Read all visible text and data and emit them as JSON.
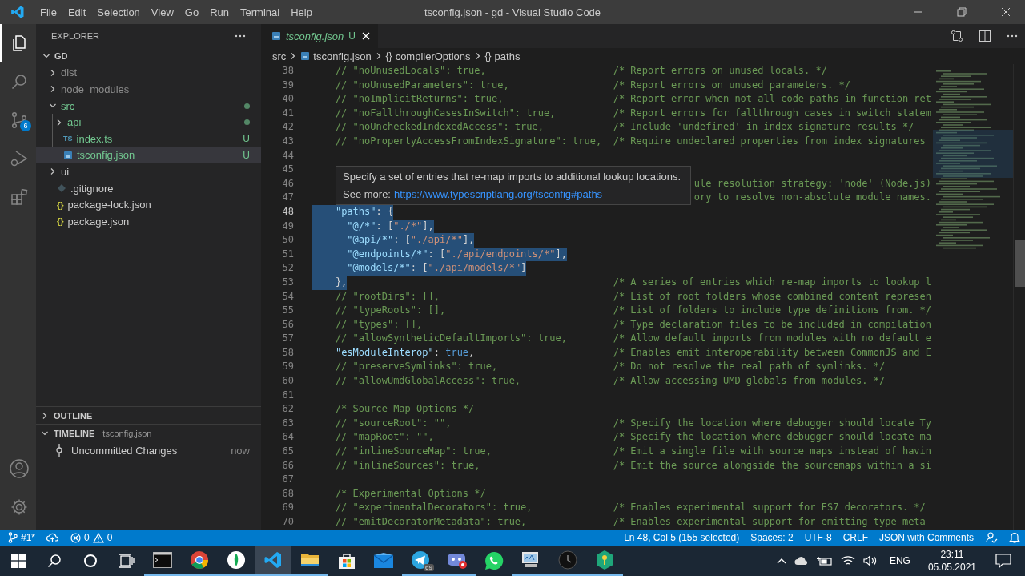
{
  "window": {
    "title": "tsconfig.json - gd - Visual Studio Code"
  },
  "menu": [
    "File",
    "Edit",
    "Selection",
    "View",
    "Go",
    "Run",
    "Terminal",
    "Help"
  ],
  "activity_bar": [
    {
      "kind": "explorer",
      "selected": true
    },
    {
      "kind": "search",
      "selected": false
    },
    {
      "kind": "source-control",
      "selected": false,
      "badge": "6"
    },
    {
      "kind": "run",
      "selected": false
    },
    {
      "kind": "extensions",
      "selected": false
    }
  ],
  "activity_bottom": [
    {
      "kind": "account"
    },
    {
      "kind": "settings"
    }
  ],
  "sidebar": {
    "title": "EXPLORER",
    "tree": [
      {
        "name": "GD",
        "kind": "root",
        "expanded": true,
        "ignored": false,
        "changed": false,
        "selected": false,
        "children": [
          {
            "name": "dist",
            "kind": "folder",
            "expanded": false,
            "ignored": true,
            "changed": false,
            "selected": false
          },
          {
            "name": "node_modules",
            "kind": "folder",
            "expanded": false,
            "ignored": true,
            "changed": false,
            "selected": false
          },
          {
            "name": "src",
            "kind": "folder",
            "expanded": true,
            "ignored": false,
            "changed": true,
            "selected": false,
            "children": [
              {
                "name": "api",
                "kind": "folder",
                "expanded": false,
                "ignored": false,
                "changed": true,
                "selected": false
              },
              {
                "name": "index.ts",
                "kind": "ts",
                "icon": "TS",
                "ignored": false,
                "changed": true,
                "badge": "U",
                "selected": false
              },
              {
                "name": "tsconfig.json",
                "kind": "tsconfig",
                "ignored": false,
                "changed": true,
                "badge": "U",
                "selected": true
              }
            ]
          },
          {
            "name": "ui",
            "kind": "folder",
            "expanded": false,
            "ignored": false,
            "changed": false,
            "selected": false
          },
          {
            "name": ".gitignore",
            "kind": "gitignore",
            "ignored": false,
            "changed": false,
            "selected": false
          },
          {
            "name": "package-lock.json",
            "kind": "json",
            "icon": "{}",
            "ignored": false,
            "changed": false,
            "selected": false
          },
          {
            "name": "package.json",
            "kind": "json",
            "icon": "{}",
            "ignored": false,
            "changed": false,
            "selected": false
          }
        ]
      }
    ],
    "outline": {
      "title": "OUTLINE",
      "expanded": false
    },
    "timeline": {
      "title": "TIMELINE",
      "file": "tsconfig.json",
      "expanded": true,
      "items": [
        {
          "label": "Uncommitted Changes",
          "time": "now"
        }
      ]
    }
  },
  "tabs": [
    {
      "label": "tsconfig.json",
      "status": "U",
      "selected": true
    }
  ],
  "breadcrumb": [
    {
      "label": "src",
      "kind": "folder"
    },
    {
      "label": "tsconfig.json",
      "kind": "file"
    },
    {
      "label": "compilerOptions",
      "kind": "object",
      "icon": "{}"
    },
    {
      "label": "paths",
      "kind": "object",
      "icon": "{}"
    }
  ],
  "editor": {
    "lines": [
      {
        "number": "38",
        "code": "    // \"noUnusedLocals\": true,",
        "comment": "/* Report errors on unused locals. */",
        "selected": false,
        "current": false
      },
      {
        "number": "39",
        "code": "    // \"noUnusedParameters\": true,",
        "comment": "/* Report errors on unused parameters. */",
        "selected": false,
        "current": false
      },
      {
        "number": "40",
        "code": "    // \"noImplicitReturns\": true,",
        "comment": "/* Report error when not all code paths in function ret",
        "selected": false,
        "current": false
      },
      {
        "number": "41",
        "code": "    // \"noFallthroughCasesInSwitch\": true,",
        "comment": "/* Report errors for fallthrough cases in switch statem",
        "selected": false,
        "current": false
      },
      {
        "number": "42",
        "code": "    // \"noUncheckedIndexedAccess\": true,",
        "comment": "/* Include 'undefined' in index signature results */",
        "selected": false,
        "current": false
      },
      {
        "number": "43",
        "code": "    // \"noPropertyAccessFromIndexSignature\": true,",
        "comment": "/* Require undeclared properties from index signatures",
        "selected": false,
        "current": false
      },
      {
        "number": "44",
        "current": false
      },
      {
        "number": "45",
        "current": false
      },
      {
        "number": "46",
        "kind": "covered",
        "comment": "ule resolution strategy: 'node' (Node.js)",
        "current": false
      },
      {
        "number": "47",
        "kind": "covered",
        "comment": "ory to resolve non-absolute module names.",
        "current": false
      },
      {
        "number": "48",
        "code": "    \"paths\": {",
        "selected": true,
        "current": true
      },
      {
        "number": "49",
        "code": "      \"@/*\": [\"./*\"],",
        "selected": true,
        "current": false
      },
      {
        "number": "50",
        "code": "      \"@api/*\": [\"./api/*\"],",
        "selected": true,
        "current": false
      },
      {
        "number": "51",
        "code": "      \"@endpoints/*\": [\"./api/endpoints/*\"],",
        "selected": true,
        "current": false
      },
      {
        "number": "52",
        "code": "      \"@models/*\": [\"./api/models/*\"]",
        "selected": true,
        "current": false
      },
      {
        "number": "53",
        "code": "    },",
        "comment": "/* A series of entries which re-map imports to lookup l",
        "selected": true,
        "current": false
      },
      {
        "number": "54",
        "code": "    // \"rootDirs\": [],",
        "comment": "/* List of root folders whose combined content represen",
        "selected": false,
        "current": false
      },
      {
        "number": "55",
        "code": "    // \"typeRoots\": [],",
        "comment": "/* List of folders to include type definitions from. */",
        "selected": false,
        "current": false
      },
      {
        "number": "56",
        "code": "    // \"types\": [],",
        "comment": "/* Type declaration files to be included in compilation",
        "selected": false,
        "current": false
      },
      {
        "number": "57",
        "code": "    // \"allowSyntheticDefaultImports\": true,",
        "comment": "/* Allow default imports from modules with no default e",
        "selected": false,
        "current": false
      },
      {
        "number": "58",
        "code": "    \"esModuleInterop\": true,",
        "comment": "/* Enables emit interoperability between CommonJS and E",
        "selected": false,
        "current": false
      },
      {
        "number": "59",
        "code": "    // \"preserveSymlinks\": true,",
        "comment": "/* Do not resolve the real path of symlinks. */",
        "selected": false,
        "current": false
      },
      {
        "number": "60",
        "code": "    // \"allowUmdGlobalAccess\": true,",
        "comment": "/* Allow accessing UMD globals from modules. */",
        "selected": false,
        "current": false
      },
      {
        "number": "61",
        "current": false
      },
      {
        "number": "62",
        "code": "    /* Source Map Options */",
        "selected": false,
        "current": false
      },
      {
        "number": "63",
        "code": "    // \"sourceRoot\": \"\",",
        "comment": "/* Specify the location where debugger should locate Ty",
        "selected": false,
        "current": false
      },
      {
        "number": "64",
        "code": "    // \"mapRoot\": \"\",",
        "comment": "/* Specify the location where debugger should locate ma",
        "selected": false,
        "current": false
      },
      {
        "number": "65",
        "code": "    // \"inlineSourceMap\": true,",
        "comment": "/* Emit a single file with source maps instead of havin",
        "selected": false,
        "current": false
      },
      {
        "number": "66",
        "code": "    // \"inlineSources\": true,",
        "comment": "/* Emit the source alongside the sourcemaps within a si",
        "selected": false,
        "current": false
      },
      {
        "number": "67",
        "current": false
      },
      {
        "number": "68",
        "code": "    /* Experimental Options */",
        "selected": false,
        "current": false
      },
      {
        "number": "69",
        "code": "    // \"experimentalDecorators\": true,",
        "comment": "/* Enables experimental support for ES7 decorators. */",
        "selected": false,
        "current": false
      },
      {
        "number": "70",
        "code": "    // \"emitDecoratorMetadata\": true,",
        "comment": "/* Enables experimental support for emitting type meta",
        "selected": false,
        "current": false
      }
    ],
    "hover": {
      "text": "Specify a set of entries that re-map imports to additional lookup locations.",
      "more_label": "See more:",
      "link": "https://www.typescriptlang.org/tsconfig#paths"
    }
  },
  "status_bar": {
    "branch": "#1*",
    "errors": "0",
    "warnings": "0",
    "position": "Ln 48, Col 5 (155 selected)",
    "indent": "Spaces: 2",
    "encoding": "UTF-8",
    "eol": "CRLF",
    "language": "JSON with Comments"
  },
  "taskbar": {
    "apps": [
      {
        "kind": "terminal",
        "running": true,
        "active": false
      },
      {
        "kind": "chrome",
        "running": true,
        "active": false
      },
      {
        "kind": "leaf",
        "running": true,
        "active": false
      },
      {
        "kind": "vscode",
        "running": true,
        "active": true
      },
      {
        "kind": "folder",
        "running": true,
        "active": false
      },
      {
        "kind": "store",
        "running": false,
        "active": false
      },
      {
        "kind": "mail",
        "running": false,
        "active": false
      },
      {
        "kind": "telegram",
        "running": true,
        "active": false,
        "badge": "69"
      },
      {
        "kind": "gamepad",
        "running": true,
        "active": false
      },
      {
        "kind": "whatsapp",
        "running": false,
        "active": false
      },
      {
        "kind": "monitor",
        "running": true,
        "active": false
      },
      {
        "kind": "clock",
        "running": true,
        "active": false
      },
      {
        "kind": "shield",
        "running": true,
        "active": false
      }
    ],
    "language": "ENG",
    "time": "23:11",
    "date": "05.05.2021"
  }
}
